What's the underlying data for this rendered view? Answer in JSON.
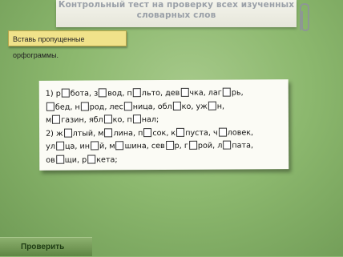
{
  "header": {
    "title_line1": "Контрольный тест на проверку всех изученных",
    "title_line2": "словарных слов"
  },
  "instruction": "Вставь пропущенные орфограммы.",
  "exercise": {
    "lines": [
      [
        "1) р",
        "бота, з",
        "вод, п",
        "льто, дев",
        "чка, лаг",
        "рь,"
      ],
      [
        "",
        "бед, н",
        "род, лес",
        "ница, обл",
        "ко, уж",
        "н,"
      ],
      [
        "м",
        "газин, ябл",
        "ко, п",
        "нал;"
      ],
      [
        "2) ж",
        "лтый, м",
        "лина, п",
        "сок, к",
        "пуста, ч",
        "ловек,"
      ],
      [
        "ул",
        "ца, ин",
        "й, м",
        "шина, сев",
        "р, г",
        "рой, л",
        "пата,"
      ],
      [
        "ов",
        "щи, р",
        "кета;"
      ]
    ]
  },
  "check_button": "Проверить"
}
